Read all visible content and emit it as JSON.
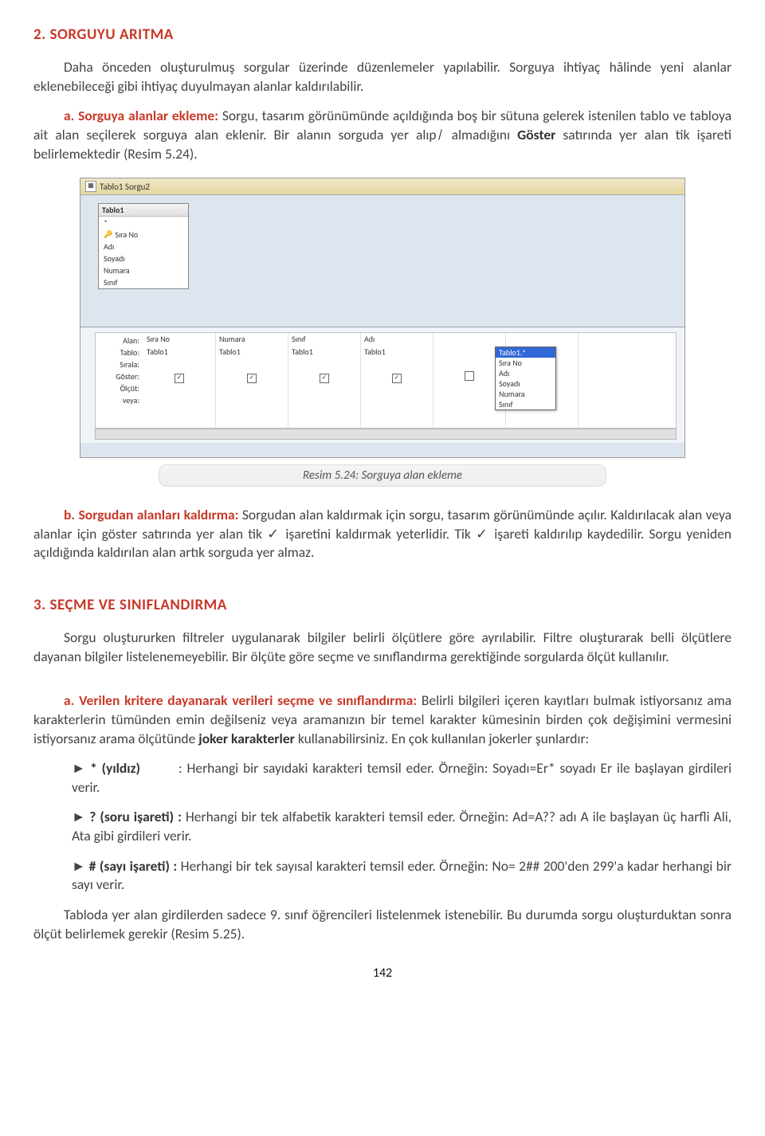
{
  "h1": "2. SORGUYU ARITMA",
  "p1a": "Daha önceden oluşturulmuş sorgular üzerinde düzenlemeler yapılabilir. Sorguya ihtiyaç hâlinde yeni alanlar eklenebileceği gibi ihtiyaç duyulmayan alanlar kaldırılabilir.",
  "p2_label": "a. Sorguya alanlar ekleme:",
  "p2a": " Sorgu, tasarım görünümünde açıldığında boş bir sütuna gelerek istenilen tablo ve tabloya ait alan seçilerek sorguya alan eklenir. Bir alanın sorguda yer alıp ̸ almadığını ",
  "p2b": "Göster",
  "p2c": " satırında yer alan     tik işareti belirlemektedir (Resim 5.24).",
  "fig": {
    "tab_label": "Tablo1 Sorgu2",
    "tablebox_title": "Tablo1",
    "fields": [
      "Sıra No",
      "Adı",
      "Soyadı",
      "Numara",
      "Sınıf"
    ],
    "grid_labels": [
      "Alan:",
      "Tablo:",
      "Sırala:",
      "Göster:",
      "Ölçüt:",
      "veya:"
    ],
    "cols": [
      {
        "alan": "Sıra No",
        "tablo": "Tablo1",
        "chk": true
      },
      {
        "alan": "Numara",
        "tablo": "Tablo1",
        "chk": true
      },
      {
        "alan": "Sınıf",
        "tablo": "Tablo1",
        "chk": true
      },
      {
        "alan": "Adı",
        "tablo": "Tablo1",
        "chk": true
      },
      {
        "alan": "",
        "tablo": "",
        "chk": false
      },
      {
        "alan": "",
        "tablo": "",
        "chk": false
      }
    ],
    "dropdown": [
      "Tablo1.*",
      "Sıra No",
      "Adı",
      "Soyadı",
      "Numara",
      "Sınıf"
    ],
    "caption": "Resim 5.24: Sorguya alan ekleme"
  },
  "p3_label": "b. Sorgudan alanları kaldırma:",
  "p3a": " Sorgudan alan kaldırmak için sorgu, tasarım görünümünde açılır. Kaldırılacak alan veya alanlar için göster satırında yer alan tik  ✓  işaretini kaldırmak yeterlidir. Tik  ✓  işareti kaldırılıp kaydedilir. Sorgu yeniden açıldığında kaldırılan alan artık sorguda yer almaz.",
  "h2": "3. SEÇME VE SINIFLANDIRMA",
  "p4": "Sorgu oluştururken filtreler uygulanarak bilgiler belirli ölçütlere göre ayrılabilir. Filtre oluşturarak belli ölçütlere dayanan bilgiler listelenemeyebilir. Bir ölçüte göre seçme ve sınıflandırma gerektiğinde sorgularda ölçüt kullanılır.",
  "p5_label": "a. Verilen kritere dayanarak verileri seçme ve sınıflandırma:",
  "p5a": " Belirli bilgileri içeren kayıtları bulmak istiyorsanız ama karakterlerin tümünden emin değilseniz veya aramanızın bir temel karakter kümesinin birden çok değişimini vermesini istiyorsanız arama ölçütünde ",
  "p5b": "joker karakterler",
  "p5c": " kullanabilirsiniz. En çok kullanılan jokerler şunlardır:",
  "b1a": "► ",
  "b1b": "* (yıldız)",
  "b1c": ": Herhangi bir sayıdaki karakteri temsil eder. Örneğin: Soyadı=Er* soyadı Er ile başlayan girdileri verir.",
  "b2a": "► ",
  "b2b": "? (soru işareti) :",
  "b2c": " Herhangi bir tek alfabetik karakteri temsil eder. Örneğin: Ad=A?? adı A ile başlayan üç harfli Ali, Ata gibi girdileri verir.",
  "b3a": "► ",
  "b3b": "# (sayı işareti) :",
  "b3c": " Herhangi bir tek sayısal karakteri temsil eder. Örneğin: No= 2## 200'den 299'a kadar herhangi bir sayı verir.",
  "p6": "Tabloda yer alan girdilerden sadece 9. sınıf öğrencileri listelenmek istenebilir. Bu durumda sorgu oluşturduktan sonra ölçüt belirlemek gerekir (Resim 5.25).",
  "page": "142"
}
